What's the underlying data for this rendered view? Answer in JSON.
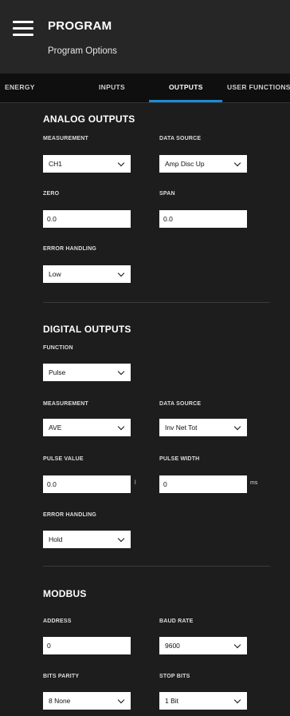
{
  "header": {
    "title": "PROGRAM",
    "subtitle": "Program Options"
  },
  "tabs": [
    {
      "label": "ENERGY"
    },
    {
      "label": "INPUTS"
    },
    {
      "label": "OUTPUTS",
      "active": true
    },
    {
      "label": "USER FUNCTIONS"
    }
  ],
  "accent_color": "#1d8bd6",
  "analog": {
    "title": "ANALOG OUTPUTS",
    "measurement_label": "MEASUREMENT",
    "measurement_value": "CH1",
    "data_source_label": "DATA SOURCE",
    "data_source_value": "Amp Disc Up",
    "zero_label": "ZERO",
    "zero_value": "0.0",
    "span_label": "SPAN",
    "span_value": "0.0",
    "error_label": "ERROR HANDLING",
    "error_value": "Low"
  },
  "digital": {
    "title": "DIGITAL OUTPUTS",
    "function_label": "FUNCTION",
    "function_value": "Pulse",
    "measurement_label": "MEASUREMENT",
    "measurement_value": "AVE",
    "data_source_label": "DATA SOURCE",
    "data_source_value": "Inv Net Tot",
    "pulse_value_label": "PULSE VALUE",
    "pulse_value": "0.0",
    "pulse_value_unit": "l",
    "pulse_width_label": "PULSE WIDTH",
    "pulse_width_value": "0",
    "pulse_width_unit": "ms",
    "error_label": "ERROR HANDLING",
    "error_value": "Hold"
  },
  "modbus": {
    "title": "MODBUS",
    "address_label": "ADDRESS",
    "address_value": "0",
    "baud_label": "BAUD RATE",
    "baud_value": "9600",
    "bits_parity_label": "BITS PARITY",
    "bits_parity_value": "8 None",
    "stop_bits_label": "STOP BITS",
    "stop_bits_value": "1 Bit"
  }
}
